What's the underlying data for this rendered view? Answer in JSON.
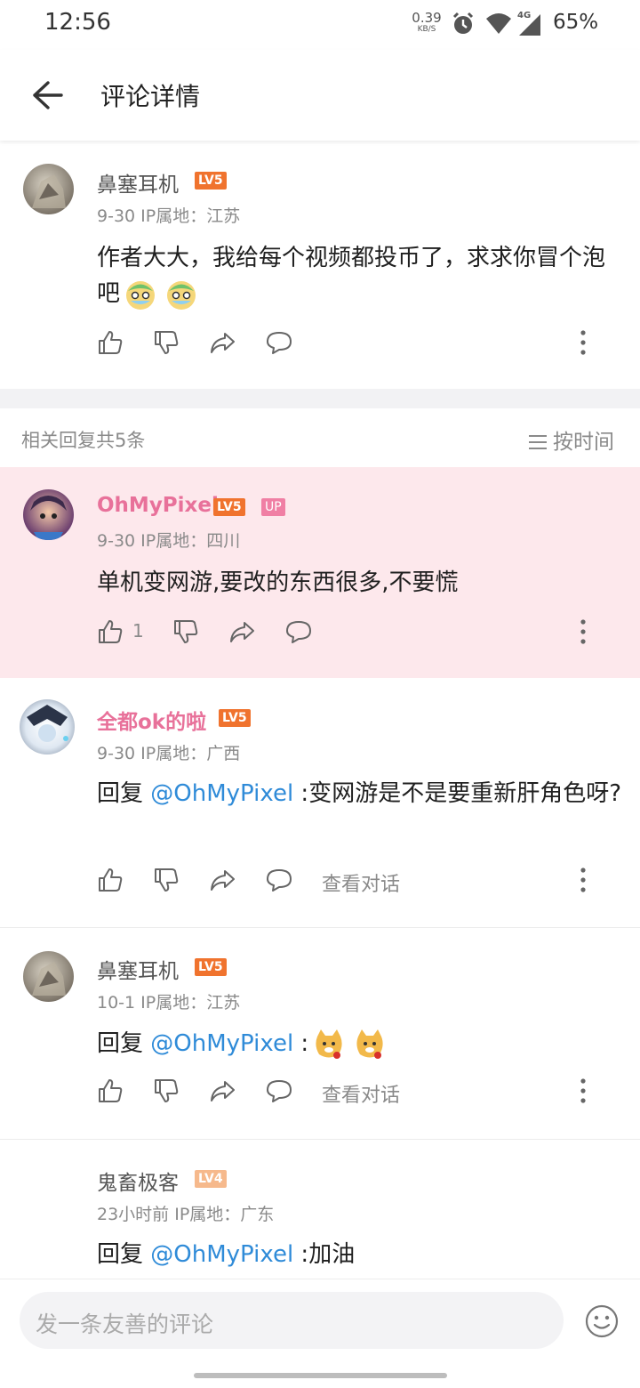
{
  "status_bar": {
    "time": "12:56",
    "net_speed_value": "0.39",
    "net_speed_unit": "KB/S",
    "network_type": "4G",
    "battery": "65%",
    "icons": [
      "alarm-icon",
      "wifi-icon",
      "signal-icon"
    ]
  },
  "header": {
    "title": "评论详情",
    "back_icon": "arrow-left-icon"
  },
  "main_comment": {
    "username": "鼻塞耳机",
    "level": "LV5",
    "date": "9-30",
    "ip": "IP属地：江苏",
    "text": "作者大大，我给每个视频都投币了，求求你冒个泡吧"
  },
  "replies_header": {
    "count_text": "相关回复共5条",
    "sort_label": "按时间"
  },
  "replies": [
    {
      "username": "OhMyPixel",
      "level": "LV5",
      "up_badge": "UP",
      "date": "9-30",
      "ip": "IP属地：四川",
      "text": "单机变网游,要改的东西很多,不要慌",
      "like_count": "1",
      "highlight_color": "#fde8ec"
    },
    {
      "username": "全都ok的啦",
      "level": "LV5",
      "date": "9-30",
      "ip": "IP属地：广西",
      "reply_prefix": "回复 ",
      "mention": "@OhMyPixel",
      "text": " :变网游是不是要重新肝角色呀?",
      "view_conversation": "查看对话"
    },
    {
      "username": "鼻塞耳机",
      "level": "LV5",
      "date": "10-1",
      "ip": "IP属地：江苏",
      "reply_prefix": "回复 ",
      "mention": "@OhMyPixel",
      "text": " :",
      "view_conversation": "查看对话"
    },
    {
      "username": "鬼畜极客",
      "level": "LV4",
      "date": "23小时前",
      "ip": "IP属地：广东",
      "reply_prefix": "回复 ",
      "mention": "@OhMyPixel",
      "text": " :加油"
    }
  ],
  "bottom_bar": {
    "placeholder": "发一条友善的评论"
  },
  "colors": {
    "pink_name": "#e8719a",
    "level_badge": "#f0732e",
    "mention": "#2f8bd8",
    "highlight": "#fde8ec"
  }
}
